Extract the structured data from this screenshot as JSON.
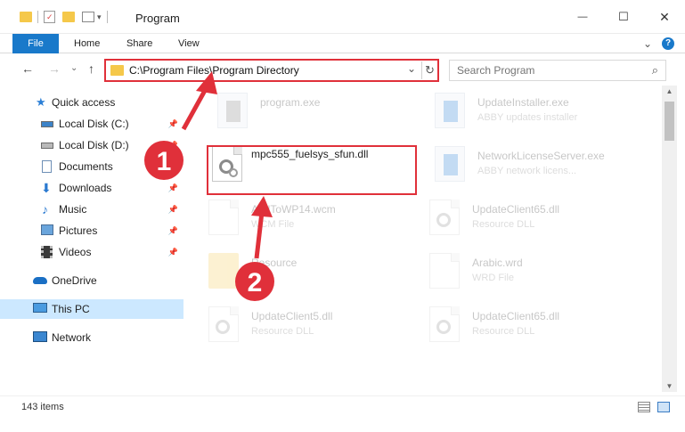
{
  "window": {
    "title": "Program",
    "minimize_glyph": "—",
    "maximize_glyph": "☐",
    "close_glyph": "✕"
  },
  "ribbon": {
    "tabs": [
      "File",
      "Home",
      "Share",
      "View"
    ],
    "expand_glyph": "⌄",
    "help_glyph": "?"
  },
  "navigation": {
    "back_glyph": "←",
    "forward_glyph": "→",
    "recent_glyph": "⌄",
    "up_glyph": "↑"
  },
  "address": {
    "path": "C:\\Program Files\\Program Directory",
    "dropdown_glyph": "⌄",
    "refresh_glyph": "↻"
  },
  "search": {
    "placeholder": "Search Program",
    "icon_glyph": "⌕"
  },
  "sidebar": {
    "items": [
      {
        "label": "Quick access",
        "icon": "star-icon",
        "pinned": false
      },
      {
        "label": "Local Disk (C:)",
        "icon": "drive-icon",
        "pinned": true
      },
      {
        "label": "Local Disk (D:)",
        "icon": "drive-icon",
        "pinned": true
      },
      {
        "label": "Documents",
        "icon": "documents-icon",
        "pinned": true
      },
      {
        "label": "Downloads",
        "icon": "download-icon",
        "pinned": true
      },
      {
        "label": "Music",
        "icon": "music-icon",
        "pinned": true
      },
      {
        "label": "Pictures",
        "icon": "pictures-icon",
        "pinned": true
      },
      {
        "label": "Videos",
        "icon": "videos-icon",
        "pinned": true
      },
      {
        "label": "OneDrive",
        "icon": "cloud-icon",
        "pinned": false
      },
      {
        "label": "This PC",
        "icon": "computer-icon",
        "pinned": false,
        "selected": true
      },
      {
        "label": "Network",
        "icon": "network-icon",
        "pinned": false
      }
    ],
    "pin_glyph": "📌"
  },
  "files": [
    {
      "name": "program.exe",
      "desc": "",
      "type": "exe"
    },
    {
      "name": "UpdateInstaller.exe",
      "desc": "ABBY updates installer",
      "type": "exe"
    },
    {
      "name": "mpc555_fuelsys_sfun.dll",
      "desc": "",
      "type": "dll",
      "highlighted": true
    },
    {
      "name": "NetworkLicenseServer.exe",
      "desc": "ABBY network licens...",
      "type": "exe"
    },
    {
      "name": "AddToWP14.wcm",
      "desc": "WCM File",
      "type": "doc"
    },
    {
      "name": "UpdateClient65.dll",
      "desc": "Resource DLL",
      "type": "dll"
    },
    {
      "name": "Resource",
      "desc": "",
      "type": "folder"
    },
    {
      "name": "Arabic.wrd",
      "desc": "WRD File",
      "type": "doc"
    },
    {
      "name": "UpdateClient5.dll",
      "desc": "Resource DLL",
      "type": "dll"
    },
    {
      "name": "UpdateClient65.dll",
      "desc": "Resource DLL",
      "type": "dll"
    }
  ],
  "status": {
    "item_count": "143 items"
  },
  "annotations": {
    "step1": "1",
    "step2": "2",
    "color": "#e0303a"
  }
}
